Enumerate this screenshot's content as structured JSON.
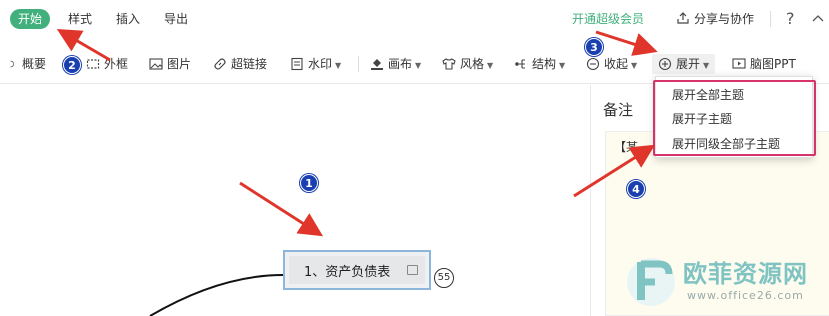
{
  "menubar": {
    "tabs": [
      "开始",
      "样式",
      "插入",
      "导出"
    ],
    "vip_label": "开通超级会员",
    "share_label": "分享与协作",
    "help_label": "?",
    "collapse_label": "^"
  },
  "toolbar": {
    "items": {
      "summary": "概要",
      "frame": "外框",
      "image": "图片",
      "hyperlink": "超链接",
      "watermark": "水印",
      "canvas": "画布",
      "style": "风格",
      "structure": "结构",
      "collapse": "收起",
      "expand": "展开",
      "mindmap_ppt": "脑图PPT"
    }
  },
  "expand_menu": {
    "items": [
      "展开全部主题",
      "展开子主题",
      "展开同级全部子主题"
    ]
  },
  "notes_panel": {
    "title": "备注",
    "content": "【某"
  },
  "canvas": {
    "topic_label": "1、资产负债表",
    "topic_count": "55"
  },
  "annotations": {
    "badges": [
      "1",
      "2",
      "3",
      "4"
    ],
    "highlight_color": "#d6336c",
    "arrow_color": "#e0352b",
    "badge_color": "#1a3fb0"
  },
  "watermark": {
    "text": "欧菲资源网",
    "url": "www.office26.com"
  },
  "colors": {
    "accent": "#41b07d",
    "topic_border": "#8cb6dc",
    "note_bg": "#fdfcef"
  }
}
